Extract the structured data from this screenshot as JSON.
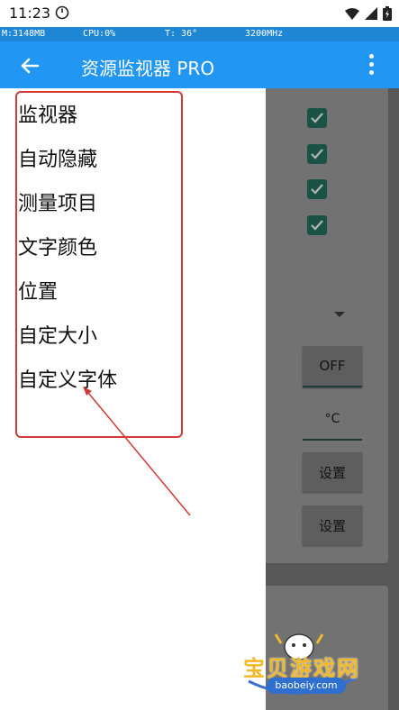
{
  "status_bar": {
    "time": "11:23"
  },
  "monitor_strip": {
    "memory": "M:3148MB",
    "cpu": "CPU:0%",
    "temperature": "T: 36°",
    "frequency": "3200MHz"
  },
  "app_bar": {
    "title": "资源监视器 PRO"
  },
  "popup_menu": {
    "items": [
      {
        "label": "监视器"
      },
      {
        "label": "自动隐藏"
      },
      {
        "label": "测量项目"
      },
      {
        "label": "文字颜色"
      },
      {
        "label": "位置"
      },
      {
        "label": "自定大小"
      },
      {
        "label": "自定义字体"
      }
    ]
  },
  "background_settings": {
    "checkboxes_checked": [
      true,
      true,
      true,
      true
    ],
    "toggle_button": "OFF",
    "unit_field": "°C",
    "set_button_1": "设置",
    "set_button_2": "设置"
  },
  "watermark": {
    "name": "宝贝游戏网",
    "url": "baobeiy.com"
  },
  "colors": {
    "app_bar": "#2196f3",
    "monitor_strip": "#1f86d6",
    "annotation": "#d33a3a",
    "checkbox": "#1a5245",
    "watermark_text": "#f1b928"
  }
}
